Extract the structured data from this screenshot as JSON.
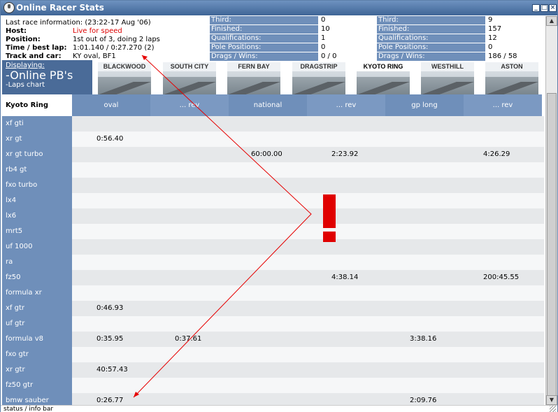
{
  "window": {
    "title": "Online Racer Stats",
    "minimize": "_",
    "maximize": "□",
    "close": "×"
  },
  "race_info": {
    "last_race": "Last race information: (23:22-17 Aug '06)",
    "host_label": "Host:",
    "host_value": "Live for speed",
    "position_label": "Position:",
    "position_value": "1st out of 3, doing 2 laps",
    "time_label": "Time / best lap:",
    "time_value": "1:01.140 / 0:27.270 (2)",
    "track_label": "Track and car:",
    "track_value": "KY oval, BF1"
  },
  "stats_left": [
    {
      "label": "Third:",
      "value": "0"
    },
    {
      "label": "Finished:",
      "value": "10"
    },
    {
      "label": "Qualifications:",
      "value": "1"
    },
    {
      "label": "Pole Positions:",
      "value": "0"
    },
    {
      "label": "Drags / Wins:",
      "value": "0 / 0"
    }
  ],
  "stats_right": [
    {
      "label": "Third:",
      "value": "9"
    },
    {
      "label": "Finished:",
      "value": "157"
    },
    {
      "label": "Qualifications:",
      "value": "12"
    },
    {
      "label": "Pole Positions:",
      "value": "0"
    },
    {
      "label": "Drags / Wins:",
      "value": "186 / 58"
    }
  ],
  "displaying": {
    "label": "Displaying:",
    "title": "-Online PB's",
    "subtitle": "-Laps chart"
  },
  "tracks": [
    "BLACKWOOD",
    "SOUTH CITY",
    "FERN BAY",
    "DRAGSTRIP",
    "KYOTO RING",
    "WESTHILL",
    "ASTON"
  ],
  "selected_track": "KYOTO RING",
  "table": {
    "corner": "Kyoto Ring",
    "columns": [
      "oval",
      "... rev",
      "national",
      "... rev",
      "gp long",
      "... rev"
    ],
    "rows": [
      {
        "car": "xf gti",
        "times": [
          "",
          "",
          "",
          "",
          "",
          ""
        ]
      },
      {
        "car": "xr gt",
        "times": [
          "0:56.40",
          "",
          "",
          "",
          "",
          ""
        ]
      },
      {
        "car": "xr gt turbo",
        "times": [
          "",
          "",
          "60:00.00",
          "2:23.92",
          "",
          "4:26.29"
        ]
      },
      {
        "car": "rb4 gt",
        "times": [
          "",
          "",
          "",
          "",
          "",
          ""
        ]
      },
      {
        "car": "fxo turbo",
        "times": [
          "",
          "",
          "",
          "",
          "",
          ""
        ]
      },
      {
        "car": "lx4",
        "times": [
          "",
          "",
          "",
          "",
          "",
          ""
        ]
      },
      {
        "car": "lx6",
        "times": [
          "",
          "",
          "",
          "",
          "",
          ""
        ]
      },
      {
        "car": "mrt5",
        "times": [
          "",
          "",
          "",
          "",
          "",
          ""
        ]
      },
      {
        "car": "uf 1000",
        "times": [
          "",
          "",
          "",
          "",
          "",
          ""
        ]
      },
      {
        "car": "ra",
        "times": [
          "",
          "",
          "",
          "",
          "",
          ""
        ]
      },
      {
        "car": "fz50",
        "times": [
          "",
          "",
          "",
          "4:38.14",
          "",
          "200:45.55"
        ]
      },
      {
        "car": "formula xr",
        "times": [
          "",
          "",
          "",
          "",
          "",
          ""
        ]
      },
      {
        "car": "xf gtr",
        "times": [
          "0:46.93",
          "",
          "",
          "",
          "",
          ""
        ]
      },
      {
        "car": "uf gtr",
        "times": [
          "",
          "",
          "",
          "",
          "",
          ""
        ]
      },
      {
        "car": "formula v8",
        "times": [
          "0:35.95",
          "0:37.61",
          "",
          "",
          "3:38.16",
          ""
        ]
      },
      {
        "car": "fxo gtr",
        "times": [
          "",
          "",
          "",
          "",
          "",
          ""
        ]
      },
      {
        "car": "xr gtr",
        "times": [
          "40:57.43",
          "",
          "",
          "",
          "",
          ""
        ]
      },
      {
        "car": "fz50 gtr",
        "times": [
          "",
          "",
          "",
          "",
          "",
          ""
        ]
      },
      {
        "car": "bmw sauber",
        "times": [
          "0:26.77",
          "",
          "",
          "",
          "2:09.76",
          ""
        ]
      }
    ]
  },
  "annotation": {
    "mark": "!",
    "color": "#e00000"
  },
  "status_bar": "status / info bar",
  "colors": {
    "header": "#6f8fba",
    "title_bar": "#3f6596",
    "live": "#dd0000"
  }
}
